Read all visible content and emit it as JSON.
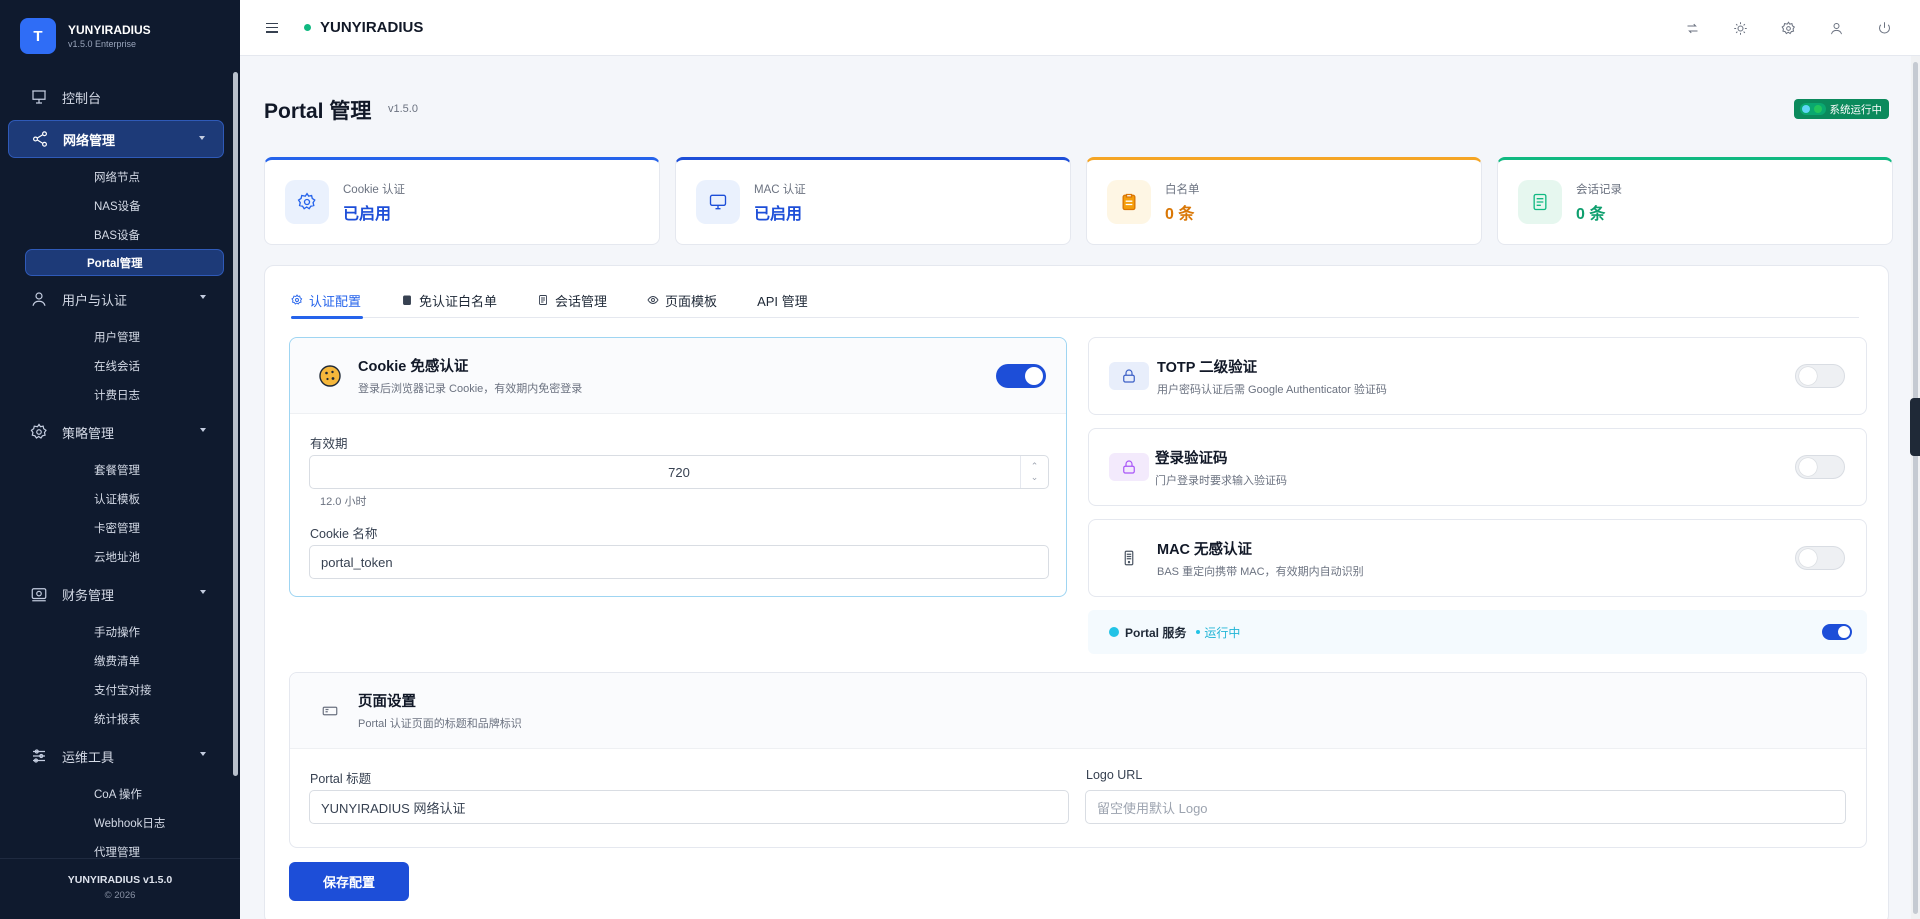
{
  "app": {
    "title": "YUNYIRADIUS",
    "version": "v1.5.0 Enterprise",
    "logo_letter": "T"
  },
  "sidebar": {
    "groups": [
      {
        "label": "控制台",
        "icon": "presentation-icon"
      },
      {
        "label": "网络管理",
        "icon": "share-icon",
        "active": true,
        "items": [
          "网络节点",
          "NAS设备",
          "BAS设备",
          "Portal管理"
        ],
        "active_item": "Portal管理"
      },
      {
        "label": "用户与认证",
        "icon": "user-icon",
        "items": [
          "用户管理",
          "在线会话",
          "计费日志"
        ]
      },
      {
        "label": "策略管理",
        "icon": "gear-icon",
        "items": [
          "套餐管理",
          "认证模板",
          "卡密管理",
          "云地址池"
        ]
      },
      {
        "label": "财务管理",
        "icon": "finance-icon",
        "items": [
          "手动操作",
          "缴费清单",
          "支付宝对接",
          "统计报表"
        ]
      },
      {
        "label": "运维工具",
        "icon": "sliders-icon",
        "items": [
          "CoA 操作",
          "Webhook日志",
          "代理管理"
        ]
      }
    ],
    "footer": {
      "version": "YUNYIRADIUS v1.5.0",
      "copyright": "© 2026"
    }
  },
  "topbar": {
    "title": "YUNYIRADIUS",
    "status_color": "#10b981"
  },
  "page": {
    "title": "Portal 管理",
    "version": "v1.5.0",
    "status": "系统运行中"
  },
  "stats": [
    {
      "label": "Cookie 认证",
      "value": "已启用",
      "color": "#2563eb"
    },
    {
      "label": "MAC 认证",
      "value": "已启用",
      "color": "#1d4ed8"
    },
    {
      "label": "白名单",
      "value": "0 条",
      "color": "#f59e0b"
    },
    {
      "label": "会话记录",
      "value": "0 条",
      "color": "#10b981"
    }
  ],
  "tabs": [
    {
      "label": "认证配置",
      "active": true
    },
    {
      "label": "免认证白名单"
    },
    {
      "label": "会话管理"
    },
    {
      "label": "页面模板"
    },
    {
      "label": "API 管理"
    }
  ],
  "cookie": {
    "title": "Cookie 免感认证",
    "desc": "登录后浏览器记录 Cookie，有效期内免密登录",
    "enabled": true,
    "validity_label": "有效期",
    "validity_value": "720",
    "validity_hint": "12.0 小时",
    "name_label": "Cookie 名称",
    "name_value": "portal_token"
  },
  "totp": {
    "title": "TOTP 二级验证",
    "desc": "用户密码认证后需 Google Authenticator 验证码",
    "enabled": false
  },
  "captcha": {
    "title": "登录验证码",
    "desc": "门户登录时要求输入验证码",
    "enabled": false
  },
  "mac": {
    "title": "MAC 无感认证",
    "desc": "BAS 重定向携带 MAC，有效期内自动识别",
    "enabled": false
  },
  "service": {
    "label": "Portal 服务",
    "status": "运行中",
    "enabled": true
  },
  "page_settings": {
    "title": "页面设置",
    "desc": "Portal 认证页面的标题和品牌标识",
    "portal_title_label": "Portal 标题",
    "portal_title_value": "YUNYIRADIUS 网络认证",
    "logo_label": "Logo URL",
    "logo_placeholder": "留空使用默认 Logo"
  },
  "actions": {
    "save": "保存配置"
  }
}
